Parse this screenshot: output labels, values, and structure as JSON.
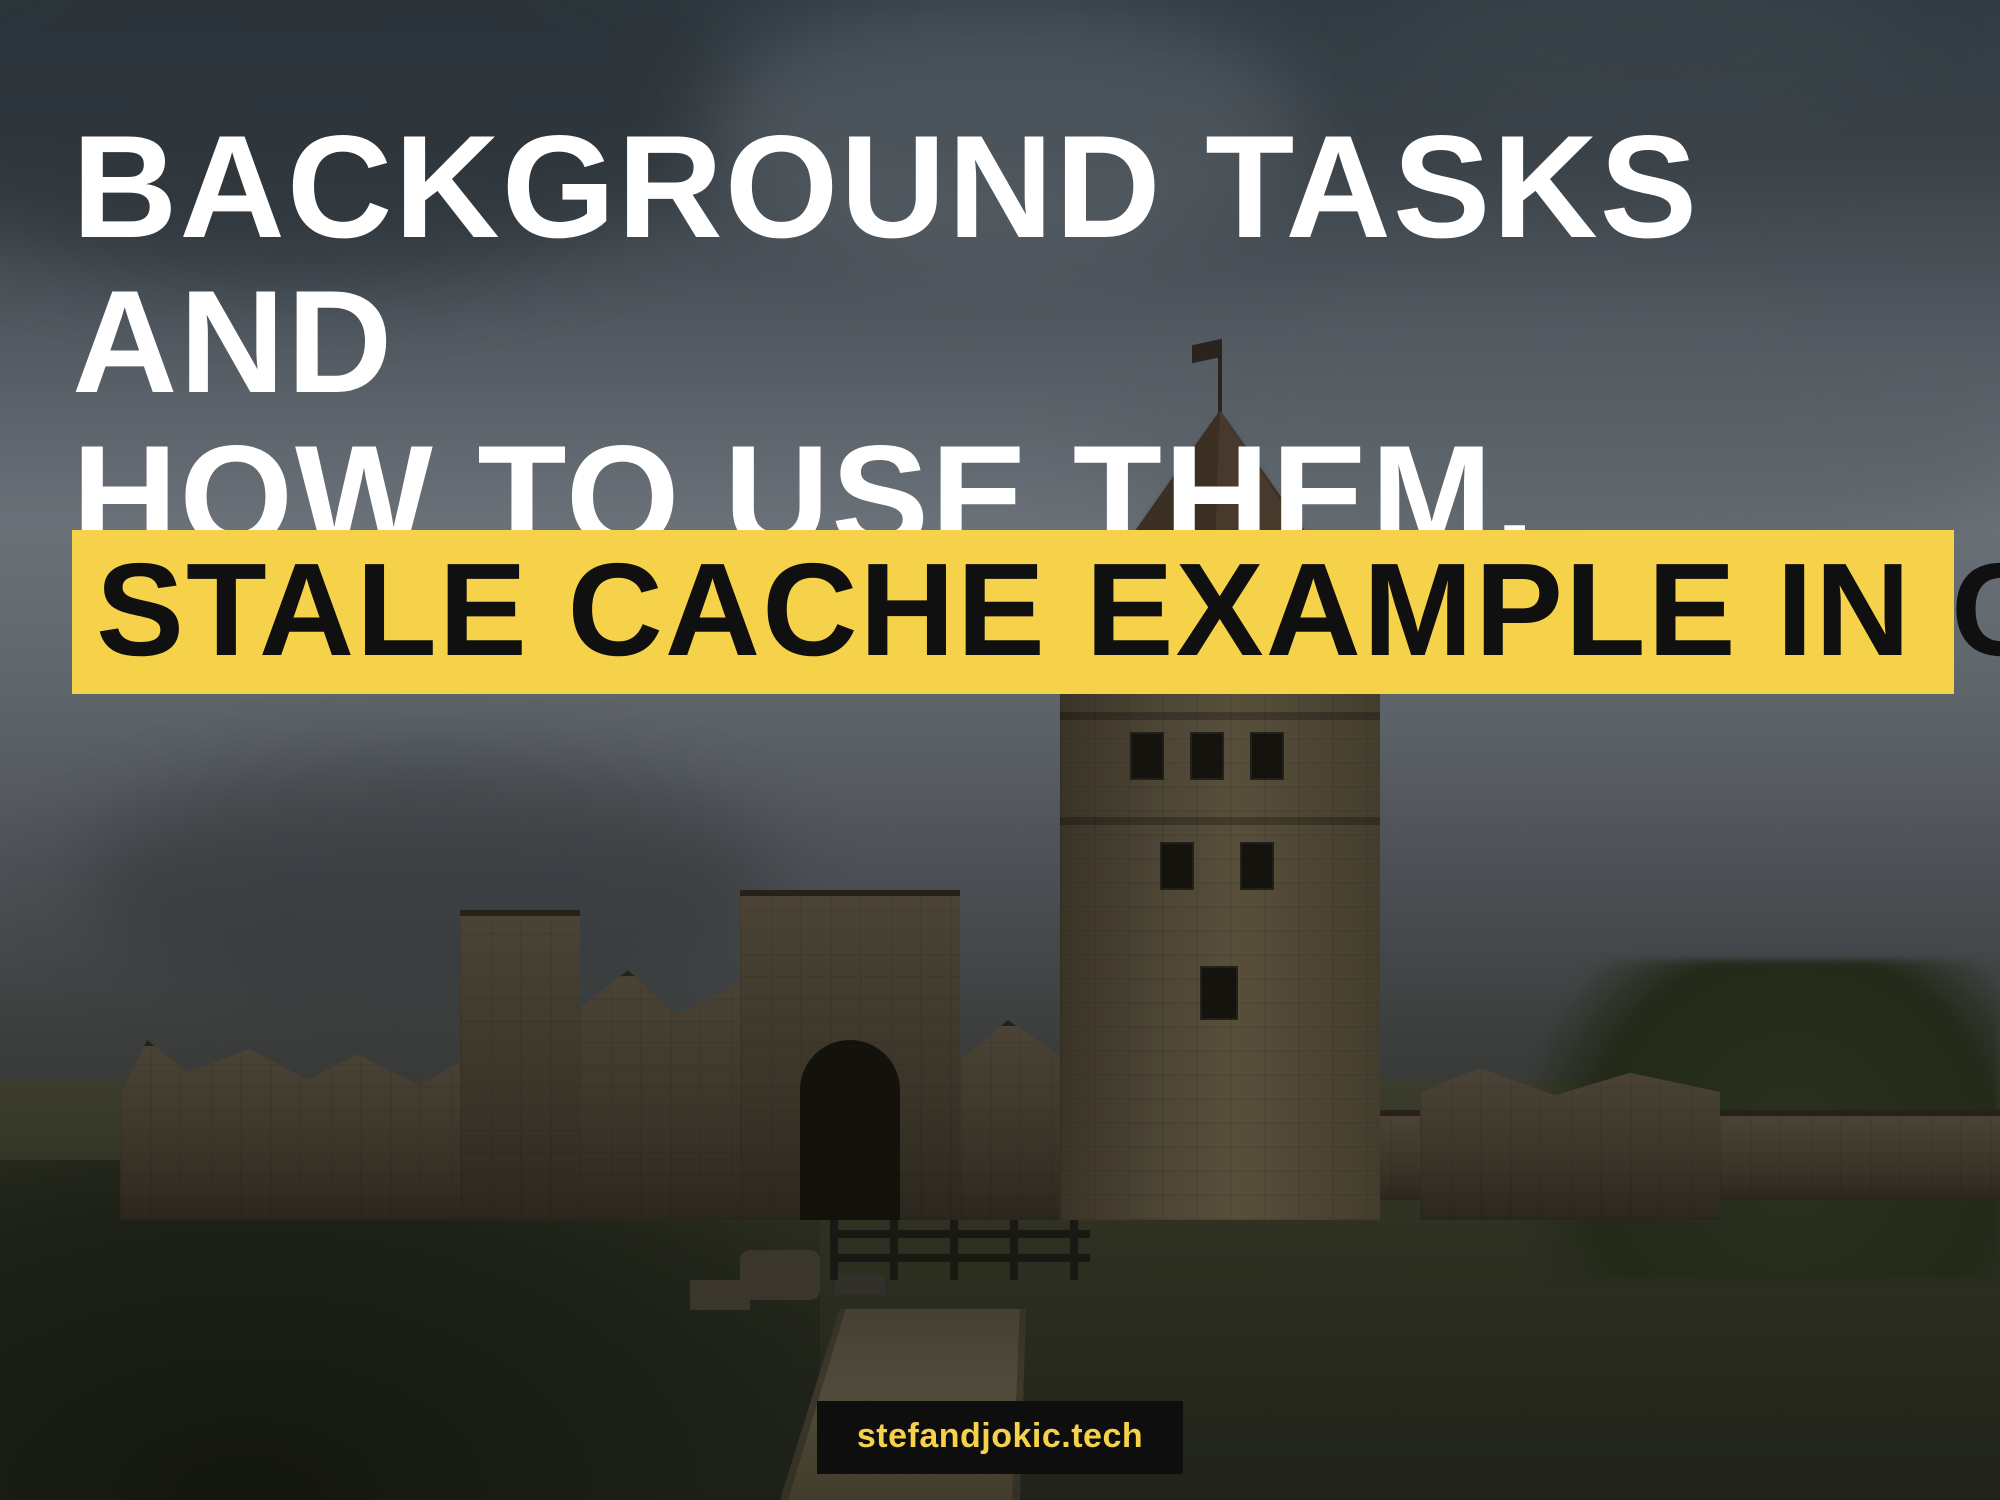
{
  "headline": {
    "line1": "Background tasks and",
    "line2": "how to use them.",
    "highlight": "Stale Cache example in C#"
  },
  "footer": {
    "site": "stefandjokic.tech"
  },
  "colors": {
    "highlight_bg": "#f5d24a",
    "highlight_text": "#101010",
    "headline_text": "#ffffff",
    "badge_bg": "#0e0e0e",
    "badge_text": "#f5d24a"
  }
}
